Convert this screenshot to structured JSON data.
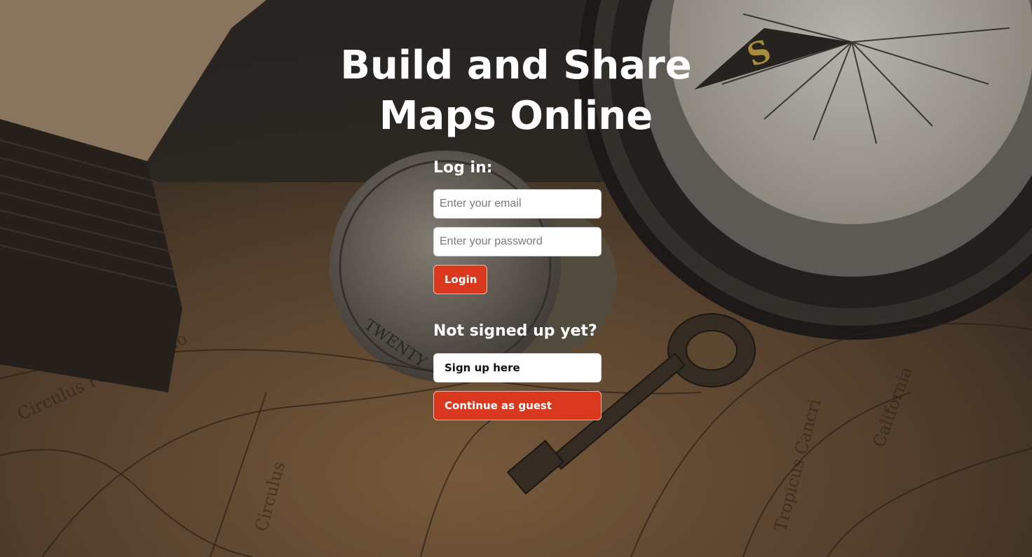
{
  "hero": {
    "title_line1": "Build and Share",
    "title_line2": "Maps Online"
  },
  "login": {
    "heading": "Log in:",
    "email_placeholder": "Enter your email",
    "password_placeholder": "Enter your password",
    "login_label": "Login"
  },
  "signup": {
    "heading": "Not signed up yet?",
    "signup_label": "Sign up here",
    "guest_label": "Continue as guest"
  },
  "colors": {
    "accent": "#d9381e",
    "text": "#ffffff"
  },
  "background": {
    "description_icon": "vintage-map-compass-coin-key-photo"
  }
}
